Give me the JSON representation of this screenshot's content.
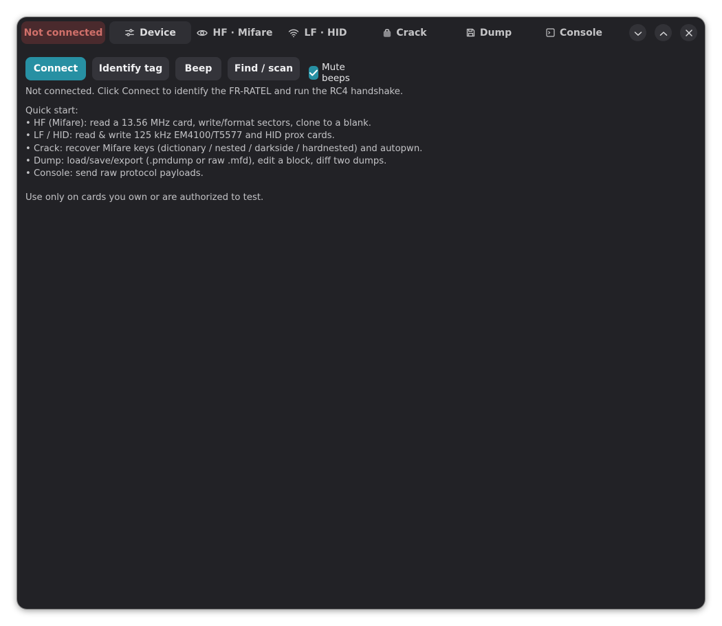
{
  "header": {
    "status": "Not connected",
    "tabs": [
      {
        "label": "Device",
        "icon": "sliders-icon",
        "active": true
      },
      {
        "label": "HF · Mifare",
        "icon": "eye-icon",
        "active": false
      },
      {
        "label": "LF · HID",
        "icon": "wifi-icon",
        "active": false
      },
      {
        "label": "Crack",
        "icon": "lock-icon",
        "active": false
      },
      {
        "label": "Dump",
        "icon": "save-icon",
        "active": false
      },
      {
        "label": "Console",
        "icon": "terminal-icon",
        "active": false
      }
    ],
    "window_controls": [
      "minimize-icon",
      "maximize-icon",
      "close-icon"
    ]
  },
  "toolbar": {
    "connect": "Connect",
    "identify": "Identify tag",
    "beep": "Beep",
    "find_scan": "Find / scan",
    "mute_label": "Mute beeps",
    "mute_checked": true
  },
  "status_line": "Not connected. Click Connect to identify the FR-RATEL and run the RC4 handshake.",
  "quick_start": {
    "heading": "Quick start:",
    "items": [
      "• HF (Mifare): read a 13.56 MHz card, write/format sectors, clone to a blank.",
      "• LF / HID: read & write 125 kHz EM4100/T5577 and HID prox cards.",
      "• Crack: recover Mifare keys (dictionary / nested / darkside / hardnested) and autopwn.",
      "• Dump: load/save/export (.pmdump or raw .mfd), edit a block, diff two dumps.",
      "• Console: send raw protocol payloads."
    ]
  },
  "disclaimer": "Use only on cards you own or are authorized to test.",
  "colors": {
    "accent": "#2790a3",
    "window_bg": "#222226",
    "status_bad_text": "#d0706a",
    "status_bad_bg": "#4a2a2d"
  }
}
